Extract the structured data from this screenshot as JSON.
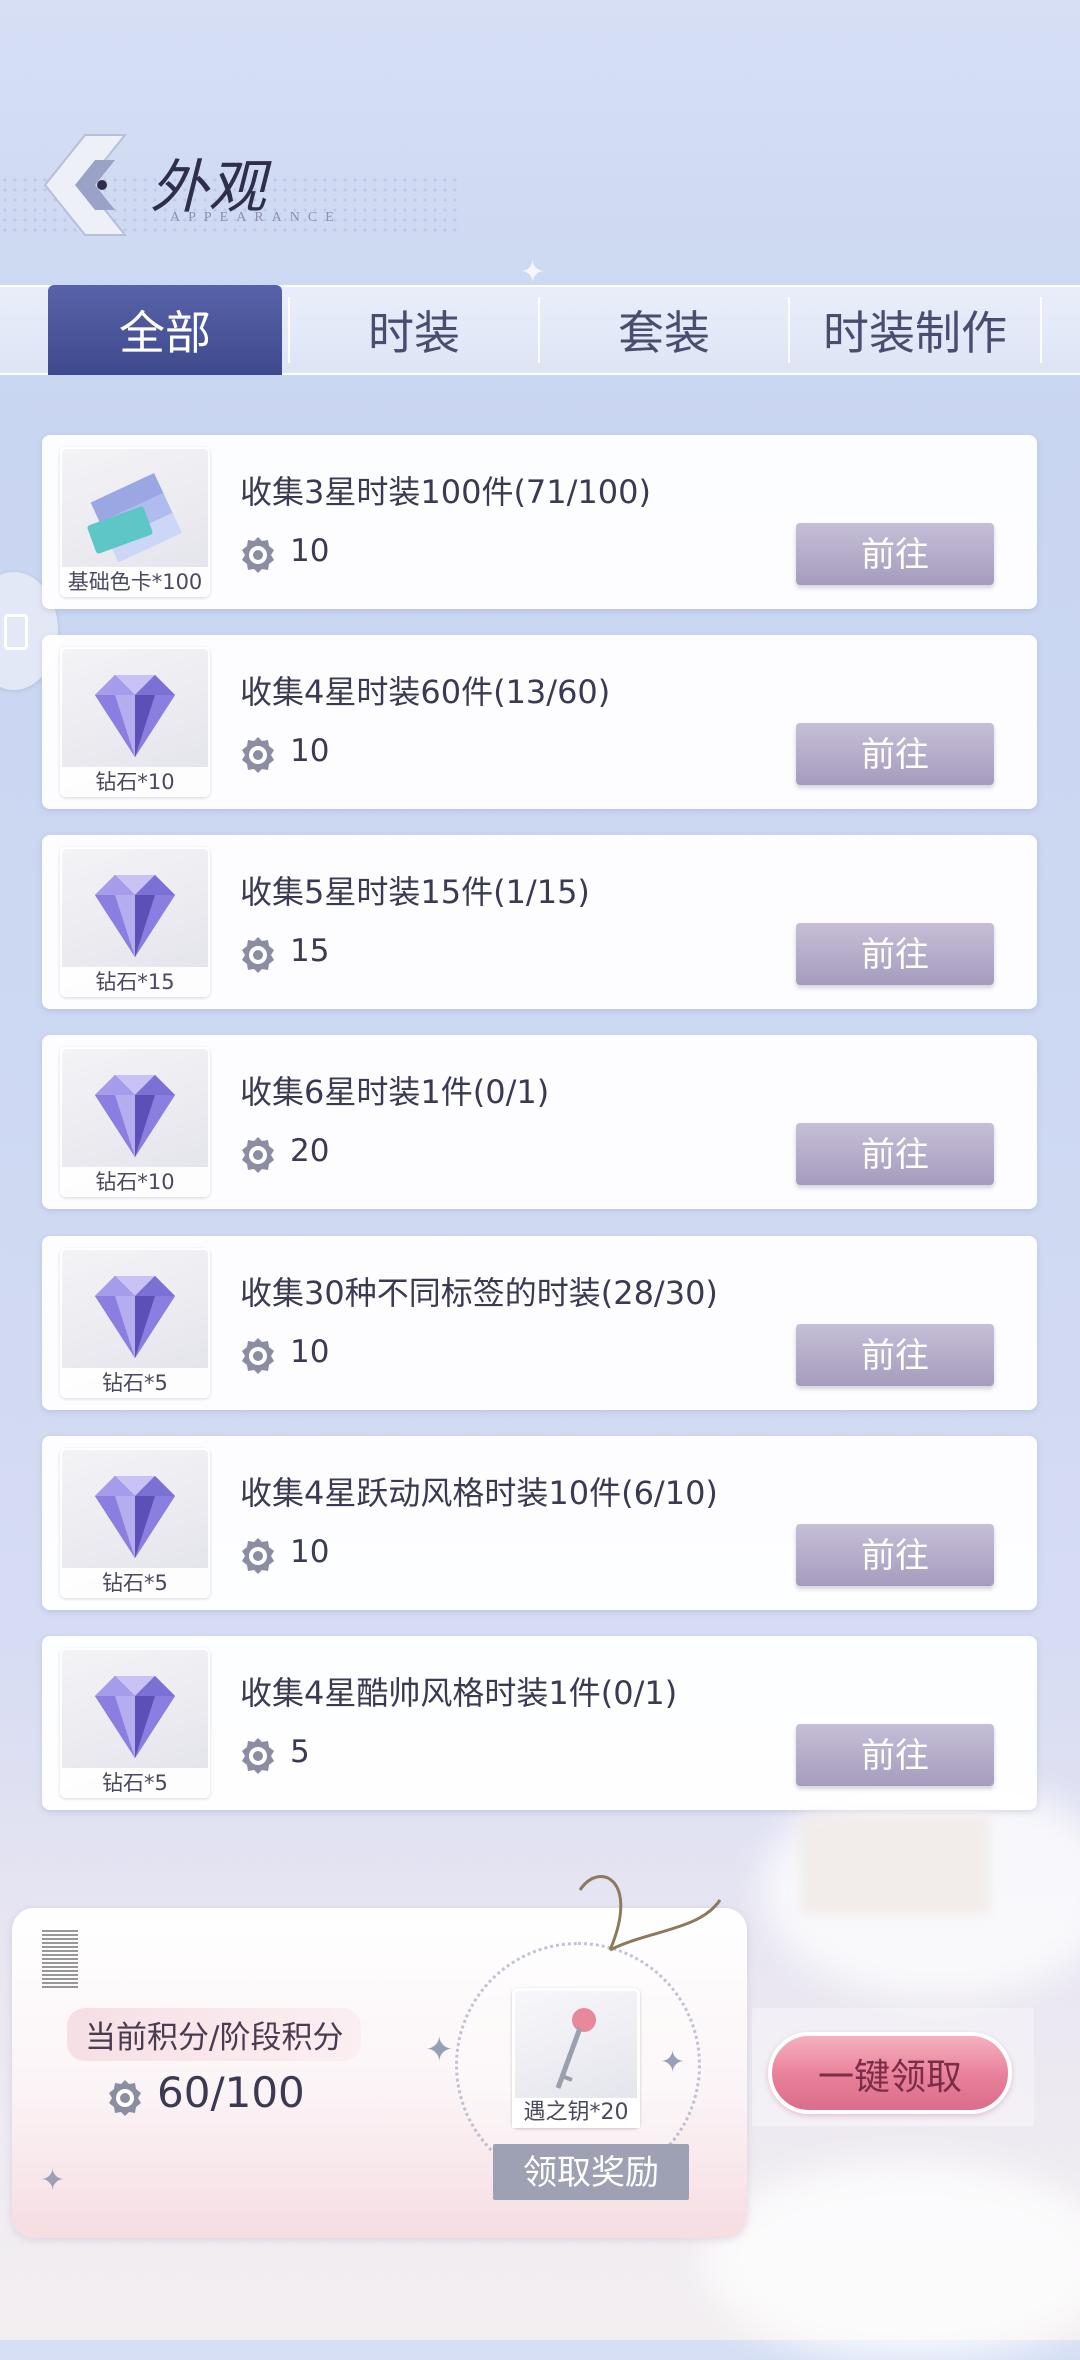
{
  "header": {
    "title": "外观",
    "subtitle": "APPEARANCE"
  },
  "tabs": [
    {
      "label": "全部",
      "active": true
    },
    {
      "label": "时装",
      "active": false
    },
    {
      "label": "套装",
      "active": false
    },
    {
      "label": "时装制作",
      "active": false
    }
  ],
  "tasks": [
    {
      "name": "收集3星时装100件(71/100)",
      "points": "10",
      "reward": "基础色卡*100",
      "reward_icon": "color-card-icon",
      "button": "前往"
    },
    {
      "name": "收集4星时装60件(13/60)",
      "points": "10",
      "reward": "钻石*10",
      "reward_icon": "diamond-icon",
      "button": "前往"
    },
    {
      "name": "收集5星时装15件(1/15)",
      "points": "15",
      "reward": "钻石*15",
      "reward_icon": "diamond-icon",
      "button": "前往"
    },
    {
      "name": "收集6星时装1件(0/1)",
      "points": "20",
      "reward": "钻石*10",
      "reward_icon": "diamond-icon",
      "button": "前往"
    },
    {
      "name": "收集30种不同标签的时装(28/30)",
      "points": "10",
      "reward": "钻石*5",
      "reward_icon": "diamond-icon",
      "button": "前往"
    },
    {
      "name": "收集4星跃动风格时装10件(6/10)",
      "points": "10",
      "reward": "钻石*5",
      "reward_icon": "diamond-icon",
      "button": "前往"
    },
    {
      "name": "收集4星酷帅风格时装1件(0/1)",
      "points": "5",
      "reward": "钻石*5",
      "reward_icon": "diamond-icon",
      "button": "前往"
    }
  ],
  "bottom": {
    "points_label": "当前积分/阶段积分",
    "points_value": "60/100",
    "stage_reward": "遇之钥*20",
    "stage_reward_icon": "key-icon",
    "claim_reward_button": "领取奖励",
    "claim_all_button": "一键领取"
  },
  "colors": {
    "tab_active": "#4a55a0",
    "go_button": "#b3a9c9",
    "claim_all": "#e98aa0"
  }
}
